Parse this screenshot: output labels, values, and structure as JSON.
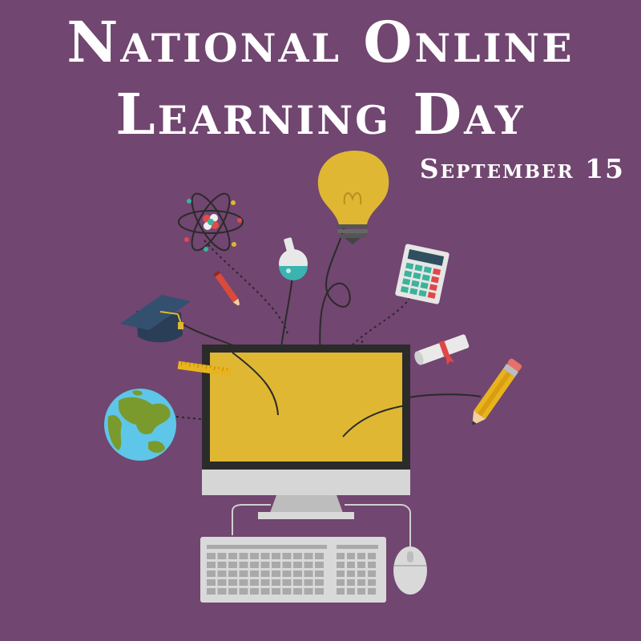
{
  "poster": {
    "title_line_1": "National Online",
    "title_line_2": "Learning Day",
    "date": "September 15"
  },
  "colors": {
    "background": "#714670",
    "title_text": "#ffffff",
    "screen": "#dfb733",
    "monitor_frame": "#2b2b2b",
    "monitor_body": "#d9d9d9"
  },
  "icons": [
    "atom-icon",
    "light-bulb-icon",
    "flask-icon",
    "calculator-icon",
    "red-pencil-icon",
    "graduation-cap-icon",
    "diploma-scroll-icon",
    "ruler-icon",
    "yellow-pencil-icon",
    "globe-icon",
    "computer-monitor-icon",
    "keyboard-icon",
    "mouse-icon"
  ]
}
